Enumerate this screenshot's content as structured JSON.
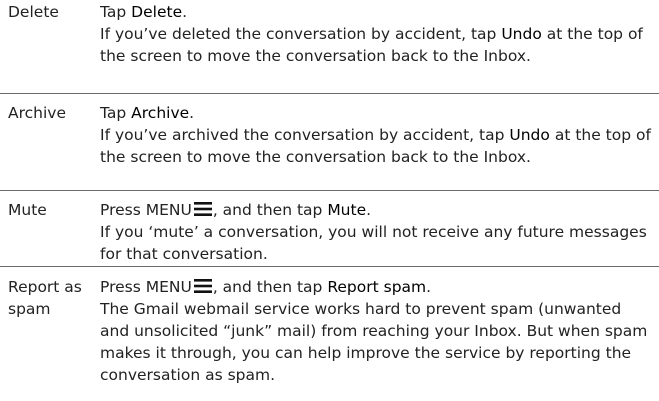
{
  "rows": [
    {
      "term": "Delete",
      "line1_pre": "Tap ",
      "line1_bold": "Delete",
      "line1_post": ".",
      "desc_pre": "If you’ve deleted the conversation by accident, tap ",
      "desc_bold": "Undo",
      "desc_post": " at the top of the screen to move the conversation back to the Inbox."
    },
    {
      "term": "Archive",
      "line1_pre": "Tap ",
      "line1_bold": "Archive",
      "line1_post": ".",
      "desc_pre": "If you’ve archived the conversation by accident, tap ",
      "desc_bold": "Undo",
      "desc_post": " at the top of the screen to move the conversation back to the Inbox."
    },
    {
      "term": "Mute",
      "line1_pre": "Press MENU",
      "line1_mid": ", and then tap ",
      "line1_bold": "Mute",
      "line1_post": ".",
      "desc": "If you ‘mute’ a conversation, you will not receive any future messages for that conversation."
    },
    {
      "term": "Report as spam",
      "line1_pre": "Press MENU",
      "line1_mid": ", and then tap ",
      "line1_bold": "Report spam",
      "line1_post": ".",
      "desc": "The Gmail webmail service works hard to prevent spam (unwanted and unsolicited “junk” mail) from reaching your Inbox. But when spam makes it through, you can help improve the service by reporting the conversation as spam."
    }
  ],
  "icons": {
    "menu": "menu-icon"
  },
  "colors": {
    "text": "#222222",
    "divider": "#6a6a6a"
  }
}
